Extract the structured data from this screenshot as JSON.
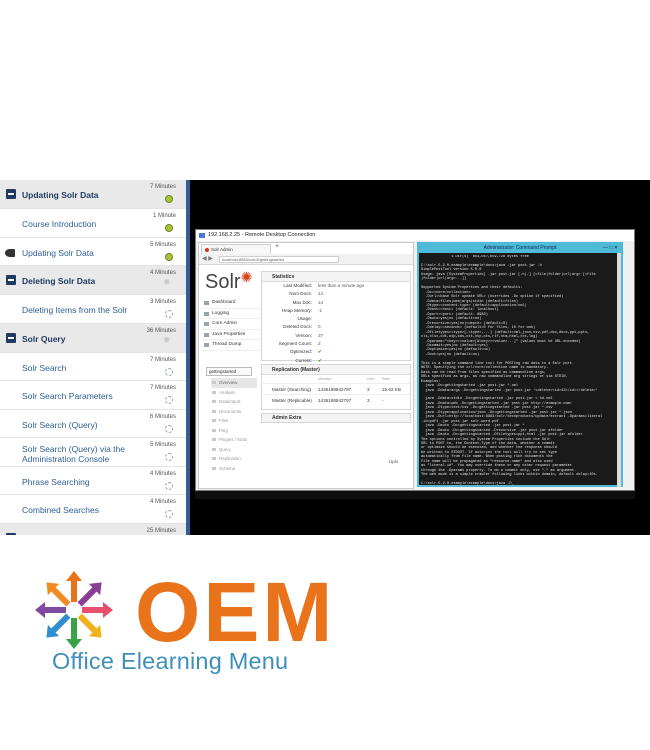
{
  "course": {
    "rows": [
      {
        "kind": "section",
        "title": "Updating Solr Data",
        "duration": "7 Minutes",
        "status": "done"
      },
      {
        "kind": "lesson",
        "title": "Course Introduction",
        "duration": "1 Minute",
        "status": "done"
      },
      {
        "kind": "lesson",
        "title": "Updating Solr Data",
        "duration": "5 Minutes",
        "status": "done",
        "current": true
      },
      {
        "kind": "section",
        "title": "Deleting Solr Data",
        "duration": "4 Minutes",
        "status": "star"
      },
      {
        "kind": "lesson",
        "title": "Deleting Items from the Solr",
        "duration": "3 Minutes",
        "status": "pend"
      },
      {
        "kind": "section",
        "title": "Solr Query",
        "duration": "36 Minutes",
        "status": "star"
      },
      {
        "kind": "lesson",
        "title": "Solr Search",
        "duration": "7 Minutes",
        "status": "pend"
      },
      {
        "kind": "lesson",
        "title": "Solr Search Parameters",
        "duration": "7 Minutes",
        "status": "pend"
      },
      {
        "kind": "lesson",
        "title": "Solr Search (Query)",
        "duration": "6 Minutes",
        "status": "pend"
      },
      {
        "kind": "lesson",
        "title": "Solr Search (Query) via the Administration Console",
        "duration": "5 Minutes",
        "status": "pend"
      },
      {
        "kind": "lesson",
        "title": "Phrase Searching",
        "duration": "4 Minutes",
        "status": "pend"
      },
      {
        "kind": "lesson",
        "title": "Combined Searches",
        "duration": "4 Minutes",
        "status": "pend"
      },
      {
        "kind": "section",
        "title": "",
        "duration": "25 Minutes",
        "status": "none"
      }
    ]
  },
  "video": {
    "rdp_title": "192.168.2.25 - Remote Desktop Connection",
    "browser": {
      "tab": "Solr Admin",
      "url": "localhost:8983/solr/#/gettingstarted",
      "logo": "Solr",
      "nav": [
        "Dashboard",
        "Logging",
        "Core Admin",
        "Java Properties",
        "Thread Dump"
      ],
      "core_selected": "gettingstarted",
      "core_menu": [
        "Overview",
        "Analysis",
        "Dataimport",
        "Documents",
        "Files",
        "Ping",
        "Plugins / Stats",
        "Query",
        "Replication",
        "Schema"
      ],
      "statistics": {
        "heading": "Statistics",
        "rows": [
          {
            "k": "Last Modified:",
            "v": "less than a minute ago"
          },
          {
            "k": "Num Docs:",
            "v": "14"
          },
          {
            "k": "Max Doc:",
            "v": "14"
          },
          {
            "k": "Heap Memory:",
            "v": "-1"
          },
          {
            "k": "Usage:",
            "v": ""
          },
          {
            "k": "Deleted Docs:",
            "v": "0"
          },
          {
            "k": "Version:",
            "v": "37"
          },
          {
            "k": "Segment Count:",
            "v": "2"
          },
          {
            "k": "Optimized:",
            "v": "✔"
          },
          {
            "k": "Current:",
            "v": "✔"
          }
        ]
      },
      "replication": {
        "heading": "Replication (Master)",
        "columns": [
          "",
          "Version",
          "Gen",
          "Size"
        ],
        "rows": [
          [
            "Master (Searching)",
            "1435198842797",
            "3",
            "15.62 KB"
          ],
          [
            "Master (Replicable)",
            "1435198842797",
            "3",
            "-"
          ]
        ]
      },
      "admin_extra": "Admin Extra",
      "upload_label": "Uplo"
    },
    "cmd": {
      "title": "Administrator: Command Prompt",
      "controls": "—  □  ✕",
      "lines": [
        "              1 Dir(s)  854,047,659,728 bytes free",
        "",
        "C:\\solr-5.2.0-example\\example\\docs>java -jar post.jar -h",
        "SimplePostTool version 5.0.0",
        "Usage: java [SystemProperties] -jar post.jar [-h|-] [<file|folder|url|arg> [<file",
        "|folder|url|arg>...]]",
        "",
        "Supported System Properties and their defaults:",
        "  -Dc=<core/collection>",
        "  -Durl=<base Solr update URL> (overrides -Dc option if specified)",
        "  -Ddata=files|web|args|stdin (default=files)",
        "  -Dtype=<content-type> (default=application/xml)",
        "  -Dhost=<host> (default: localhost)",
        "  -Dport=<port> (default: 8983)",
        "  -Dauto=yes|no (default=no)",
        "  -Drecursive=yes|no|<depth> (default=0)",
        "  -Ddelay=<seconds> (default=0 for files, 10 for web)",
        "  -Dfiletypes=<type>[,<type>,...] (default=xml,json,csv,pdf,doc,docx,ppt,pptx,",
        "xls,xlsx,odt,odp,ods,ott,otp,ots,rtf,htm,html,txt,log)",
        "  -Dparams=\"<key>=<value>[&<key>=<value>...]\" (values must be URL-encoded)",
        "  -Dcommit=yes|no (default=yes)",
        "  -Doptimize=yes|no (default=no)",
        "  -Dout=yes|no (default=no)",
        "",
        "This is a simple command line tool for POSTing raw data to a Solr port.",
        "NOTE: Specifying the url/core/collection name is mandatory.",
        "Data can be read from files specified as commandline args,",
        "URLs specified as args, as raw commandline arg strings or via STDIN.",
        "Examples:",
        "  java -Dc=gettingstarted -jar post.jar *.xml",
        "  java -Ddata=args -Dc=gettingstarted -jar post.jar '<delete><id>42</id></delete>'",
        "",
        "  java -Ddata=stdin -Dc=gettingstarted -jar post.jar < hd.xml",
        "  java -Ddata=web -Dc=gettingstarted -jar post.jar http://example.com/",
        "  java -Dtype=text/csv -Dc=gettingstarted -jar post.jar *.csv",
        "  java -Dtype=application/json -Dc=gettingstarted -jar post.jar *.json",
        "  java -Durl=http://localhost:8983/solr/techproducts/update/extract -Dparams=literal",
        ".id=pdf1 -jar post.jar solr-word.pdf",
        "  java -Dauto -Dc=gettingstarted -jar post.jar *",
        "  java -Dauto -Dc=gettingstarted -Drecursive -jar post.jar afolder",
        "  java -Dauto -Dc=gettingstarted -Dfiletypes=ppt,html -jar post.jar afolder",
        "The options controlled by System Properties include the Solr",
        "URL to POST to, the Content-Type of the data, whether a commit",
        "or optimize should be executed, and whether the response should",
        "be written to STDOUT. If auto=yes the tool will try to set type",
        "automatically from file name. When posting rich documents the",
        "file name will be propagated as \"resource.name\" and also used",
        "as \"literal.id\". You may override these or any other request parameter",
        "through the -Dparams property. To do a commit only, use \"-\" as argument.",
        "The web mode is a simple crawler following links within domain, default delay=10s.",
        "",
        "C:\\solr-5.2.0-example\\example\\docs>java -D_"
      ]
    }
  },
  "logo": {
    "wordmark": "OEM",
    "tagline": "Office Elearning Menu",
    "colors": {
      "orange": "#e8731a",
      "blue": "#3f8fb8"
    },
    "arrow_colors": [
      "#e8731a",
      "#8b3e96",
      "#e94f6b",
      "#f2b21c",
      "#3aa34a",
      "#2f8fcf",
      "#7f4aa0",
      "#f08a24"
    ]
  }
}
